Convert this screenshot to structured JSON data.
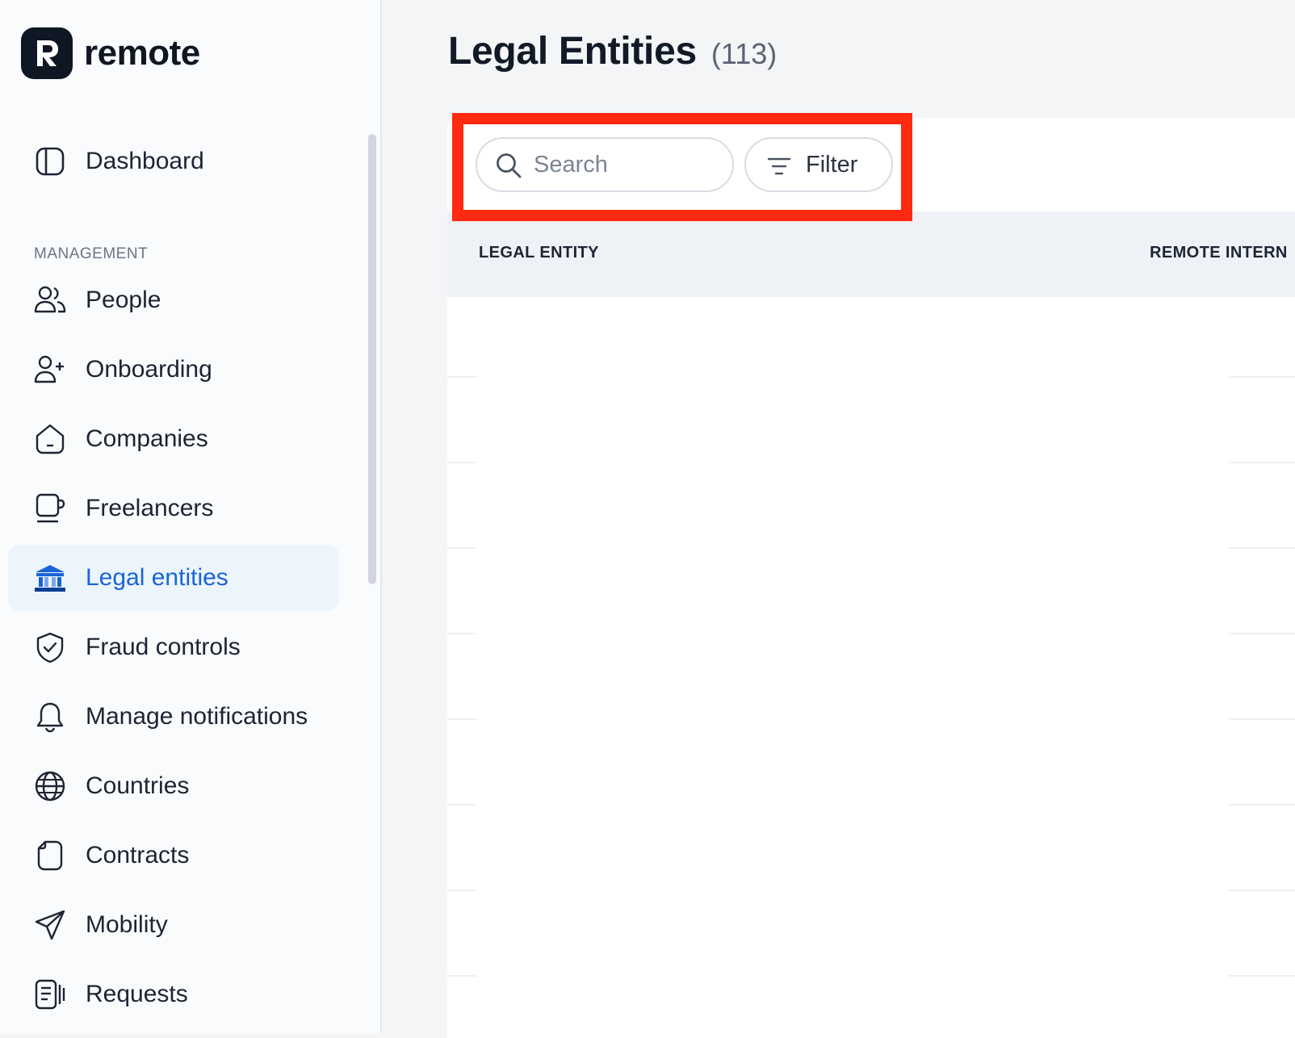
{
  "app": {
    "brand": "remote"
  },
  "sidebar": {
    "top_item": {
      "label": "Dashboard",
      "icon": "dashboard-icon"
    },
    "section_label": "MANAGEMENT",
    "items": [
      {
        "label": "People",
        "icon": "people-icon"
      },
      {
        "label": "Onboarding",
        "icon": "onboarding-icon"
      },
      {
        "label": "Companies",
        "icon": "companies-icon"
      },
      {
        "label": "Freelancers",
        "icon": "freelancers-icon"
      },
      {
        "label": "Legal entities",
        "icon": "legal-entities-icon",
        "active": true
      },
      {
        "label": "Fraud controls",
        "icon": "shield-check-icon"
      },
      {
        "label": "Manage notifications",
        "icon": "bell-icon"
      },
      {
        "label": "Countries",
        "icon": "globe-icon"
      },
      {
        "label": "Contracts",
        "icon": "document-icon"
      },
      {
        "label": "Mobility",
        "icon": "paper-plane-icon"
      },
      {
        "label": "Requests",
        "icon": "requests-icon"
      }
    ]
  },
  "main": {
    "title": "Legal Entities",
    "count": "(113)",
    "search": {
      "placeholder": "Search",
      "value": ""
    },
    "filter_label": "Filter",
    "table": {
      "columns": [
        "LEGAL ENTITY",
        "REMOTE INTERN"
      ]
    }
  },
  "colors": {
    "accent": "#1a64d8",
    "active_bg": "#edf5fc",
    "highlight": "#ff2a10",
    "brand_dark": "#0f1724"
  }
}
